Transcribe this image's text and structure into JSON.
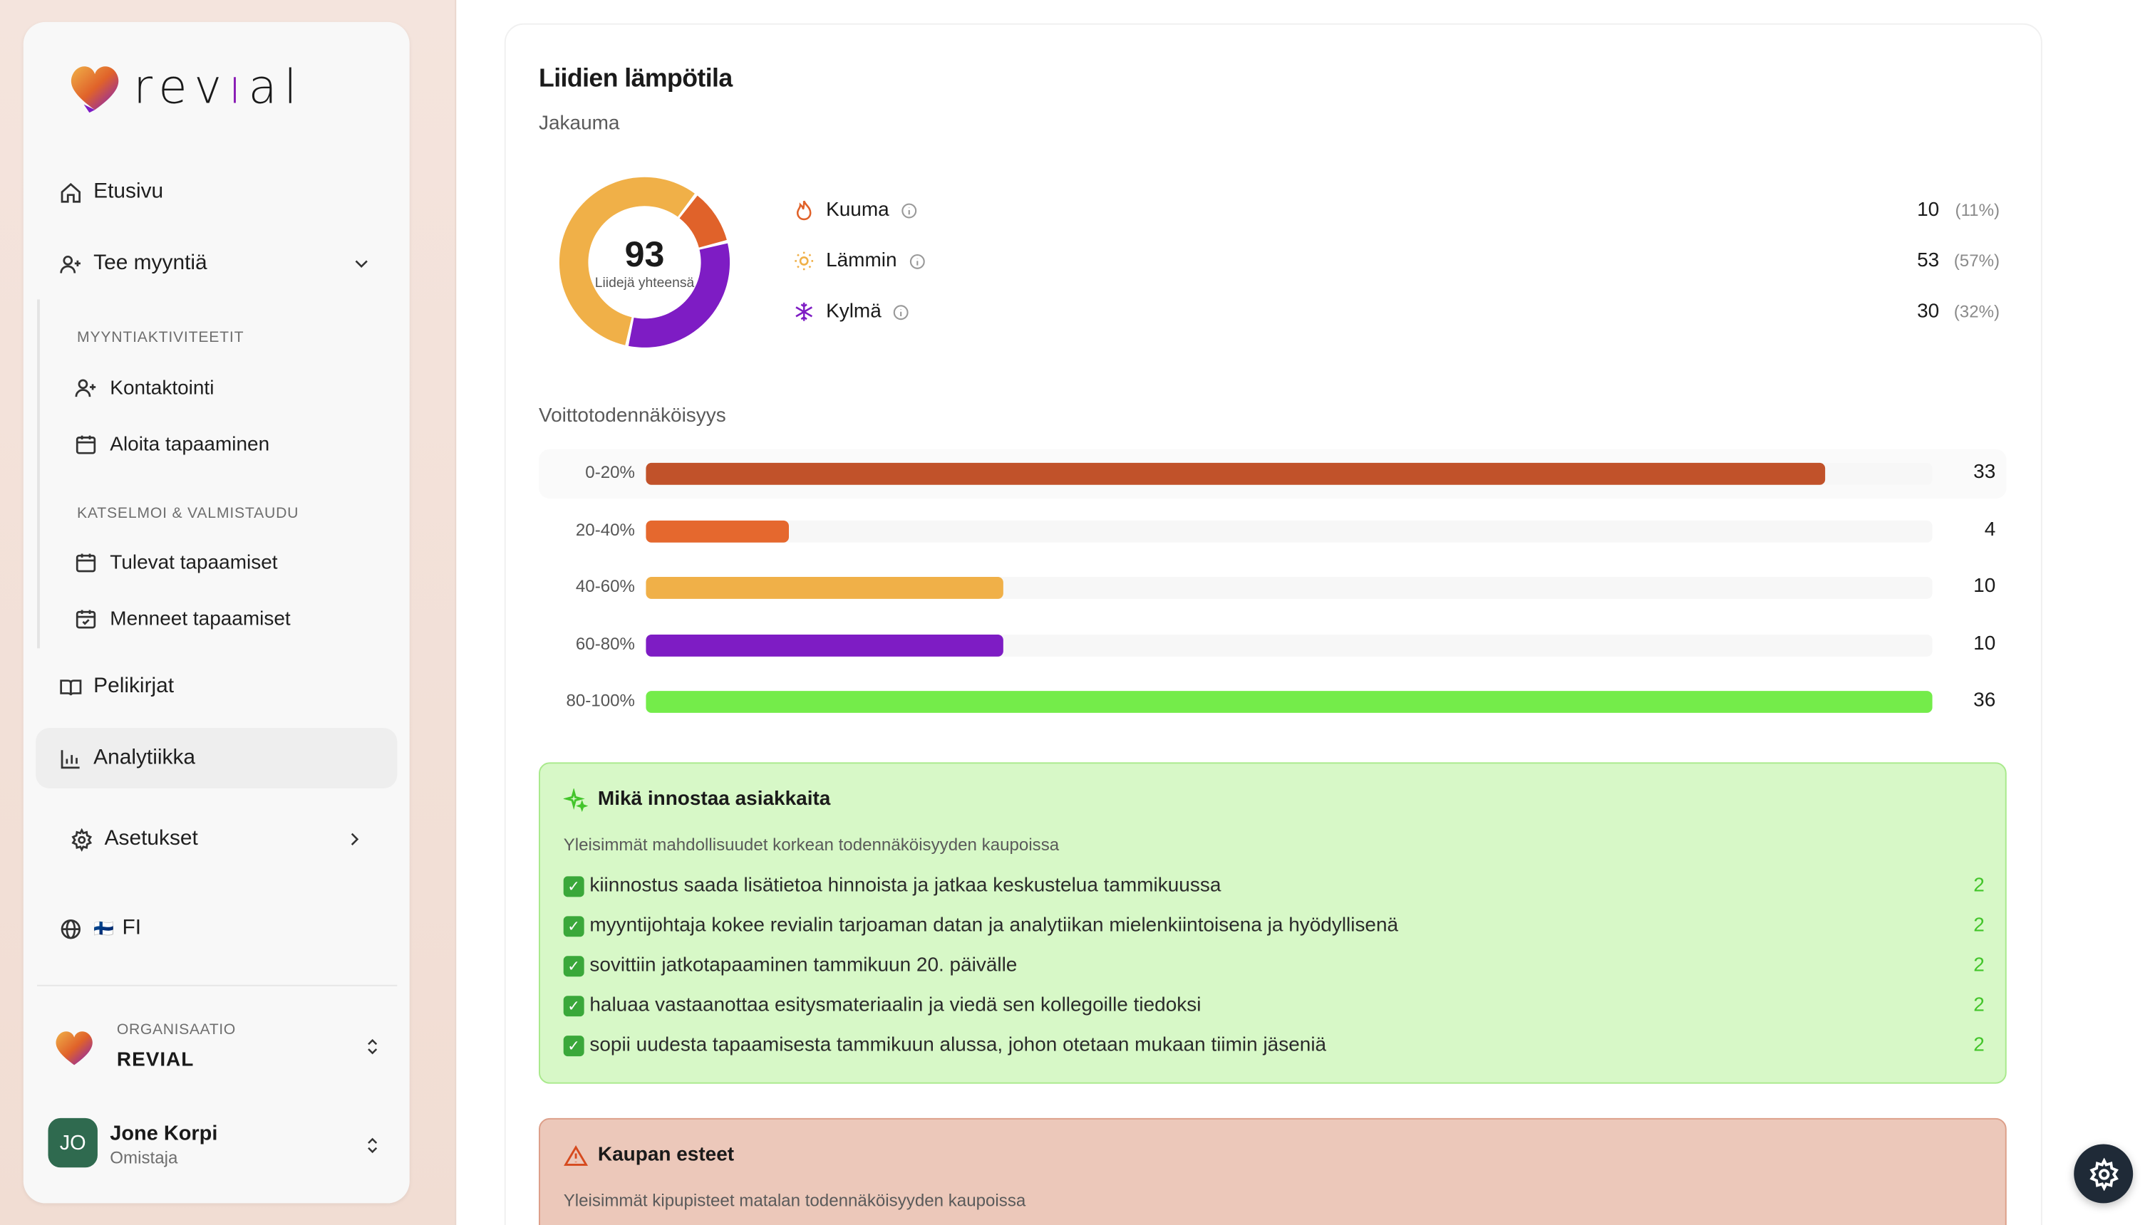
{
  "brand": {
    "name_left": "rev",
    "name_bar": "ı",
    "name_right": "al"
  },
  "sidebar": {
    "home": "Etusivu",
    "sell": "Tee myyntiä",
    "section_activities": "MYYNTIAKTIVITEETIT",
    "contacting": "Kontaktointi",
    "start_meeting": "Aloita tapaaminen",
    "section_review": "KATSELMOI & VALMISTAUDU",
    "upcoming": "Tulevat tapaamiset",
    "past": "Menneet tapaamiset",
    "playbooks": "Pelikirjat",
    "analytics": "Analytiikka",
    "settings": "Asetukset",
    "language_flag": "🇫🇮",
    "language": "FI"
  },
  "org": {
    "label": "ORGANISAATIO",
    "name": "REVIAL"
  },
  "user": {
    "initials": "JO",
    "name": "Jone Korpi",
    "role": "Omistaja"
  },
  "temperature": {
    "title": "Liidien lämpötila",
    "subtitle": "Jakauma",
    "total": "93",
    "total_label": "Liidejä yhteensä",
    "items": [
      {
        "name": "Kuuma",
        "value": "10",
        "pct": "(11%)",
        "color": "#e0622a"
      },
      {
        "name": "Lämmin",
        "value": "53",
        "pct": "(57%)",
        "color": "#f0b048"
      },
      {
        "name": "Kylmä",
        "value": "30",
        "pct": "(32%)",
        "color": "#7e1cc4"
      }
    ]
  },
  "chart_data": {
    "type": "bar",
    "title": "Voittotodennäköisyys",
    "categories": [
      "0-20%",
      "20-40%",
      "40-60%",
      "60-80%",
      "80-100%"
    ],
    "values": [
      33,
      4,
      10,
      10,
      36
    ],
    "colors": [
      "#c1522a",
      "#e5682e",
      "#f0b048",
      "#7e1cc4",
      "#74ec4a"
    ],
    "orientation": "horizontal",
    "max": 36
  },
  "motivators": {
    "title": "Mikä innostaa asiakkaita",
    "subtitle": "Yleisimmät mahdollisuudet korkean todennäköisyyden kaupoissa",
    "items": [
      {
        "text": "kiinnostus saada lisätietoa hinnoista ja jatkaa keskustelua tammikuussa",
        "count": "2"
      },
      {
        "text": "myyntijohtaja kokee revialin tarjoaman datan ja analytiikan mielenkiintoisena ja hyödyllisenä",
        "count": "2"
      },
      {
        "text": "sovittiin jatkotapaaminen tammikuun 20. päivälle",
        "count": "2"
      },
      {
        "text": "haluaa vastaanottaa esitysmateriaalin ja viedä sen kollegoille tiedoksi",
        "count": "2"
      },
      {
        "text": "sopii uudesta tapaamisesta tammikuun alussa, johon otetaan mukaan tiimin jäseniä",
        "count": "2"
      }
    ]
  },
  "obstacles": {
    "title": "Kaupan esteet",
    "subtitle": "Yleisimmät kipupisteet matalan todennäköisyyden kaupoissa"
  }
}
